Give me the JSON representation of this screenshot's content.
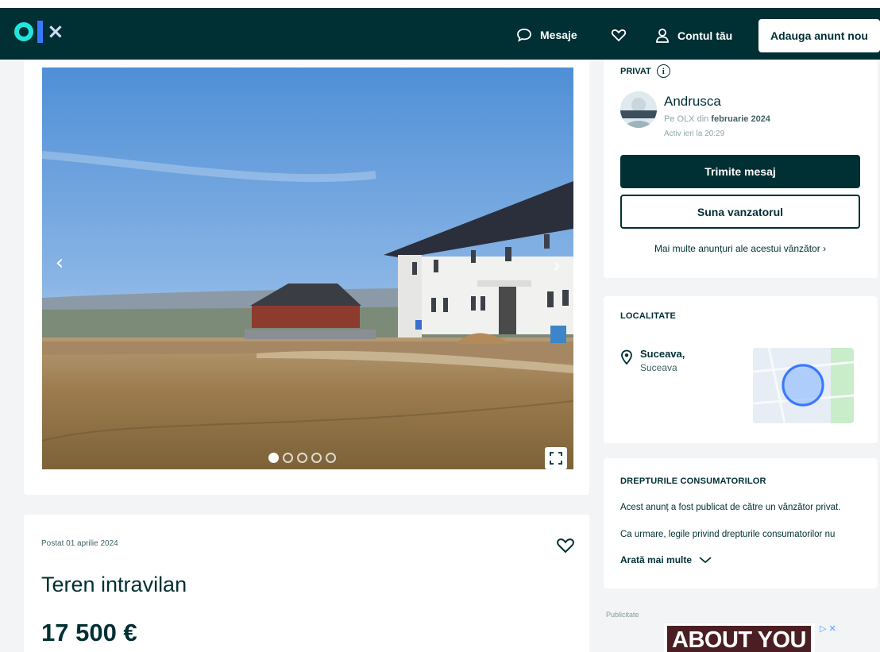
{
  "header": {
    "logo_text": "OLX",
    "messages_label": "Mesaje",
    "account_label": "Contul tău",
    "add_ad_label": "Adauga anunt nou"
  },
  "gallery": {
    "dots_total": 5,
    "active_dot": 1
  },
  "listing": {
    "posted": "Postat 01 aprilie 2024",
    "title": "Teren intravilan",
    "price": "17 500 €"
  },
  "seller": {
    "type_label": "PRIVAT",
    "name": "Andrusca",
    "since_prefix": "Pe OLX din",
    "since_date": "februarie 2024",
    "last_active": "Activ ieri la 20:29",
    "message_button": "Trimite mesaj",
    "call_button": "Suna vanzatorul",
    "more_ads_link": "Mai multe anunțuri ale acestui vânzător"
  },
  "location": {
    "section_title": "LOCALITATE",
    "city": "Suceava,",
    "region": "Suceava"
  },
  "consumer_rights": {
    "section_title": "DREPTURILE CONSUMATORILOR",
    "line1": "Acest anunț a fost publicat de către un vânzător privat.",
    "line2": "Ca urmare, legile privind drepturile consumatorilor nu",
    "show_more": "Arată mai multe"
  },
  "advert": {
    "label": "Publicitate",
    "brand": "ABOUT YOU"
  },
  "colors": {
    "brand_dark": "#002f34",
    "logo_teal": "#23e5db",
    "logo_blue": "#3a77ff"
  }
}
